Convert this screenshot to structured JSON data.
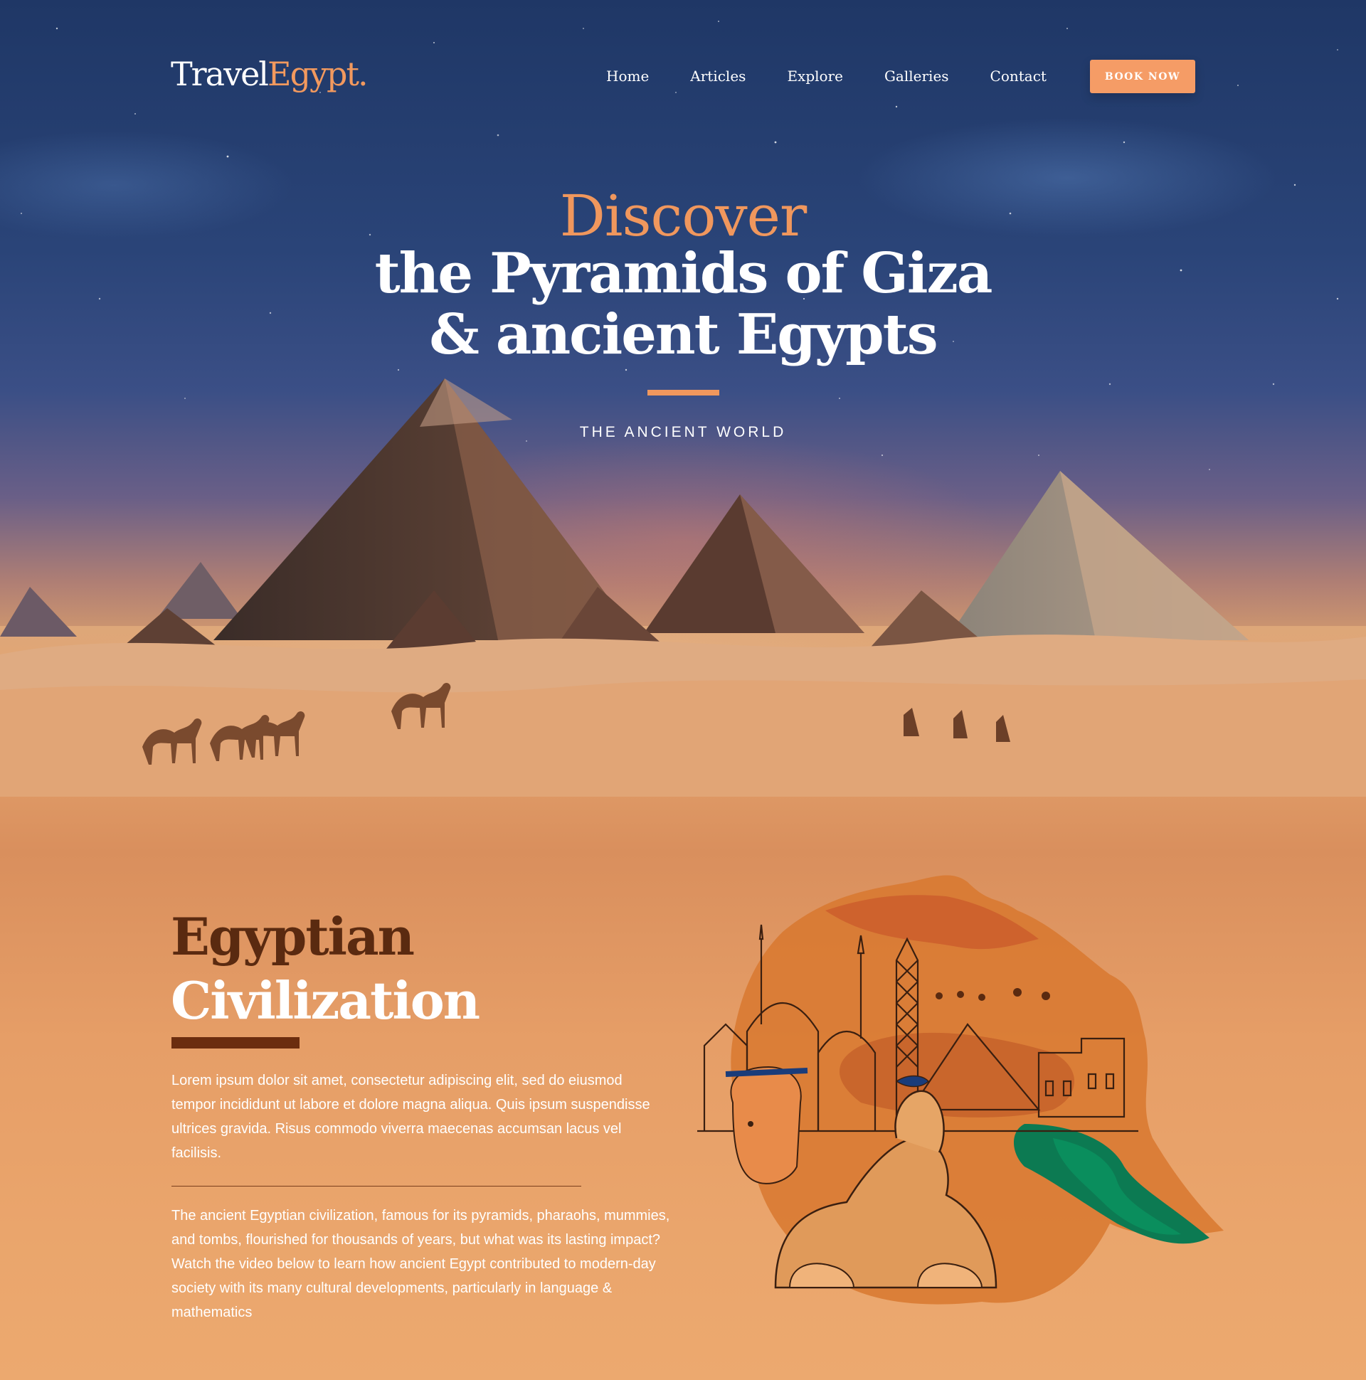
{
  "brand": {
    "part1": "Travel",
    "part2": "Egypt."
  },
  "nav": {
    "items": [
      "Home",
      "Articles",
      "Explore",
      "Galleries",
      "Contact"
    ],
    "cta": "BOOK NOW"
  },
  "hero": {
    "kicker": "Discover",
    "title_line1": "the Pyramids of Giza",
    "title_line2": "& ancient Egypts",
    "subtitle": "THE ANCIENT WORLD"
  },
  "section": {
    "title_line1": "Egyptian",
    "title_line2": "Civilization",
    "paragraph1": "Lorem ipsum dolor sit amet, consectetur adipiscing elit, sed do eiusmod tempor incididunt ut labore et dolore magna aliqua. Quis ipsum suspendisse ultrices gravida. Risus commodo viverra maecenas accumsan lacus vel facilisis.",
    "paragraph2": "The ancient Egyptian civilization, famous for its pyramids, pharaohs, mummies, and tombs, flourished for thousands of years, but what was its lasting impact? Watch the video below to learn how ancient Egypt contributed to modern-day society with its many cultural developments, particularly in language & mathematics"
  },
  "colors": {
    "accent": "#f0975d",
    "button": "#f59c66",
    "heading_dark": "#5a2a10",
    "rule_dark": "#6b2d0f",
    "night_sky": "#1f3766",
    "sand": "#eaa56c"
  }
}
